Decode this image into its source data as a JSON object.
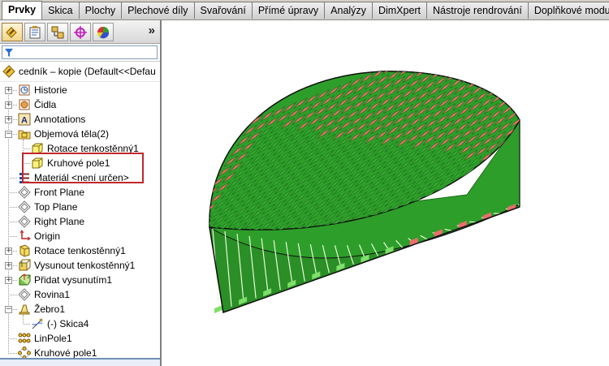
{
  "tabs": [
    "Prvky",
    "Skica",
    "Plochy",
    "Plechové díly",
    "Svařování",
    "Přímé úpravy",
    "Analýzy",
    "DimXpert",
    "Nástroje rendrování",
    "Doplňkové modu"
  ],
  "active_tab": "Prvky",
  "panel": {
    "toolbar_icons": [
      "feature-manager-icon",
      "property-manager-icon",
      "configuration-manager-icon",
      "dimxpert-manager-icon",
      "display-manager-icon"
    ],
    "expand_glyph": "»",
    "root_label": "cedník – kopie  (Default<<Defau",
    "tree": [
      {
        "label": "Historie",
        "icon": "history-icon"
      },
      {
        "label": "Čidla",
        "icon": "sensor-icon"
      },
      {
        "label": "Annotations",
        "icon": "annotation-icon"
      },
      {
        "label": "Objemová těla(2)",
        "icon": "solid-bodies-folder-icon"
      },
      {
        "label": "Rotace tenkostěnný1",
        "icon": "solid-body-icon"
      },
      {
        "label": "Kruhové pole1",
        "icon": "solid-body-icon"
      },
      {
        "label": "Materiál <není určen>",
        "icon": "material-icon"
      },
      {
        "label": "Front Plane",
        "icon": "plane-icon"
      },
      {
        "label": "Top Plane",
        "icon": "plane-icon"
      },
      {
        "label": "Right Plane",
        "icon": "plane-icon"
      },
      {
        "label": "Origin",
        "icon": "origin-icon"
      },
      {
        "label": "Rotace tenkostěnný1",
        "icon": "revolve-icon"
      },
      {
        "label": "Vysunout tenkostěnný1",
        "icon": "extrude-icon"
      },
      {
        "label": "Přidat vysunutím1",
        "icon": "boss-extrude-icon"
      },
      {
        "label": "Rovina1",
        "icon": "plane-icon"
      },
      {
        "label": "Žebro1",
        "icon": "rib-icon"
      },
      {
        "label": "(-) Skica4",
        "icon": "sketch-icon"
      },
      {
        "label": "LinPole1",
        "icon": "linear-pattern-icon"
      },
      {
        "label": "Kruhové pole1",
        "icon": "circular-pattern-icon"
      }
    ]
  },
  "colors": {
    "body_green": "#2e9e2a",
    "body_dark_green": "#1a6e18",
    "face_red": "#ee6c6c",
    "highlight_box": "#c0282d",
    "tab_bg": "#d4d0c8"
  }
}
